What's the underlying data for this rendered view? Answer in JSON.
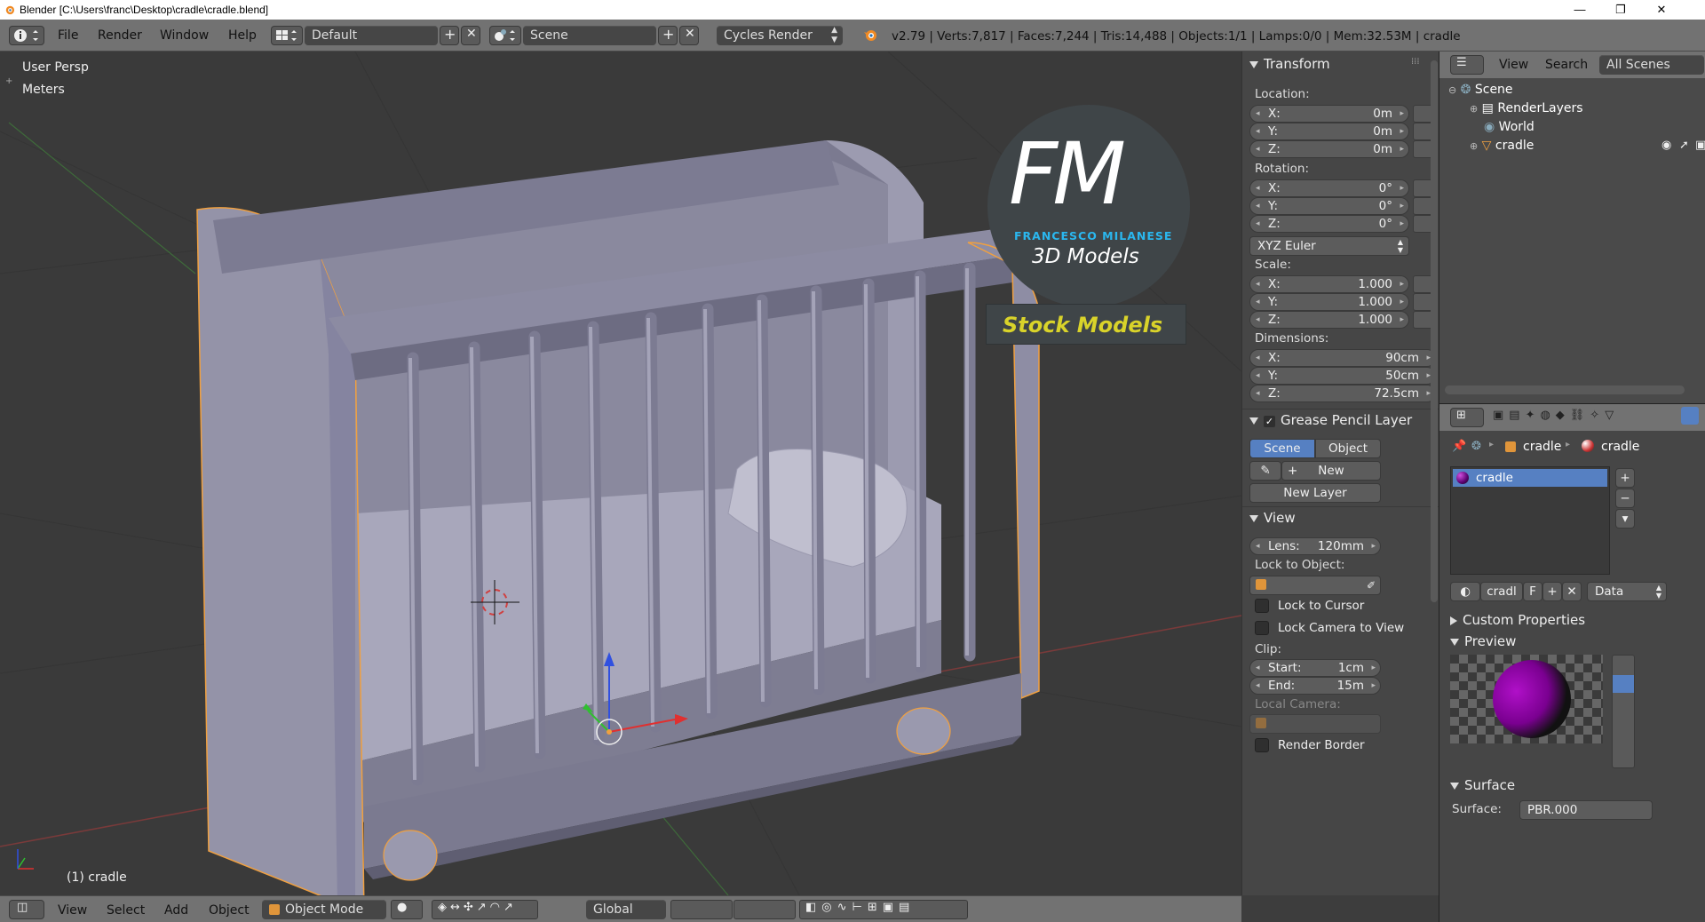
{
  "window": {
    "title": "Blender [C:\\Users\\franc\\Desktop\\cradle\\cradle.blend]",
    "min": "—",
    "max": "❐",
    "close": "✕"
  },
  "topbar": {
    "menus": [
      "File",
      "Render",
      "Window",
      "Help"
    ],
    "layout": "Default",
    "scene": "Scene",
    "engine": "Cycles Render",
    "stats": "v2.79 | Verts:7,817 | Faces:7,244 | Tris:14,488 | Objects:1/1 | Lamps:0/0 | Mem:32.53M | cradle"
  },
  "viewport": {
    "view_name": "User Persp",
    "units": "Meters",
    "object_label": "(1) cradle",
    "watermark": {
      "initials": "FM",
      "name": "FRANCESCO MILANESE",
      "line2": "3D Models",
      "banner": "Stock Models"
    }
  },
  "npanel": {
    "transform_title": "Transform",
    "location_label": "Location:",
    "location": [
      {
        "k": "X:",
        "v": "0m"
      },
      {
        "k": "Y:",
        "v": "0m"
      },
      {
        "k": "Z:",
        "v": "0m"
      }
    ],
    "rotation_label": "Rotation:",
    "rotation": [
      {
        "k": "X:",
        "v": "0°"
      },
      {
        "k": "Y:",
        "v": "0°"
      },
      {
        "k": "Z:",
        "v": "0°"
      }
    ],
    "rotation_mode": "XYZ Euler",
    "scale_label": "Scale:",
    "scale": [
      {
        "k": "X:",
        "v": "1.000"
      },
      {
        "k": "Y:",
        "v": "1.000"
      },
      {
        "k": "Z:",
        "v": "1.000"
      }
    ],
    "dimensions_label": "Dimensions:",
    "dimensions": [
      {
        "k": "X:",
        "v": "90cm"
      },
      {
        "k": "Y:",
        "v": "50cm"
      },
      {
        "k": "Z:",
        "v": "72.5cm"
      }
    ],
    "gp_title": "Grease Pencil Layer",
    "gp_scene": "Scene",
    "gp_object": "Object",
    "gp_new": "New",
    "gp_new_layer": "New Layer",
    "view_title": "View",
    "lens_label": "Lens:",
    "lens_value": "120mm",
    "lock_object_label": "Lock to Object:",
    "lock_cursor": "Lock to Cursor",
    "lock_camera": "Lock Camera to View",
    "clip_label": "Clip:",
    "clip_start_k": "Start:",
    "clip_start_v": "1cm",
    "clip_end_k": "End:",
    "clip_end_v": "15m",
    "local_camera": "Local Camera:",
    "render_border": "Render Border"
  },
  "outliner": {
    "view": "View",
    "search": "Search",
    "filter": "All Scenes",
    "items": [
      "Scene",
      "RenderLayers",
      "World",
      "cradle"
    ]
  },
  "properties": {
    "crumb1": "cradle",
    "crumb2": "cradle",
    "material": "cradle",
    "mat_name": "cradl",
    "mat_f": "F",
    "data_link": "Data",
    "custom_props": "Custom Properties",
    "preview": "Preview",
    "surface": "Surface",
    "surface_label": "Surface:",
    "surface_value": "PBR.000"
  },
  "bottombar": {
    "view": "View",
    "select": "Select",
    "add": "Add",
    "object": "Object",
    "mode": "Object Mode",
    "orientation": "Global"
  },
  "colors": {
    "header_gray": "#727272",
    "selected_blue": "#5680c2",
    "origin_orange": "#f0a040",
    "material_purple": "#b010c8"
  }
}
